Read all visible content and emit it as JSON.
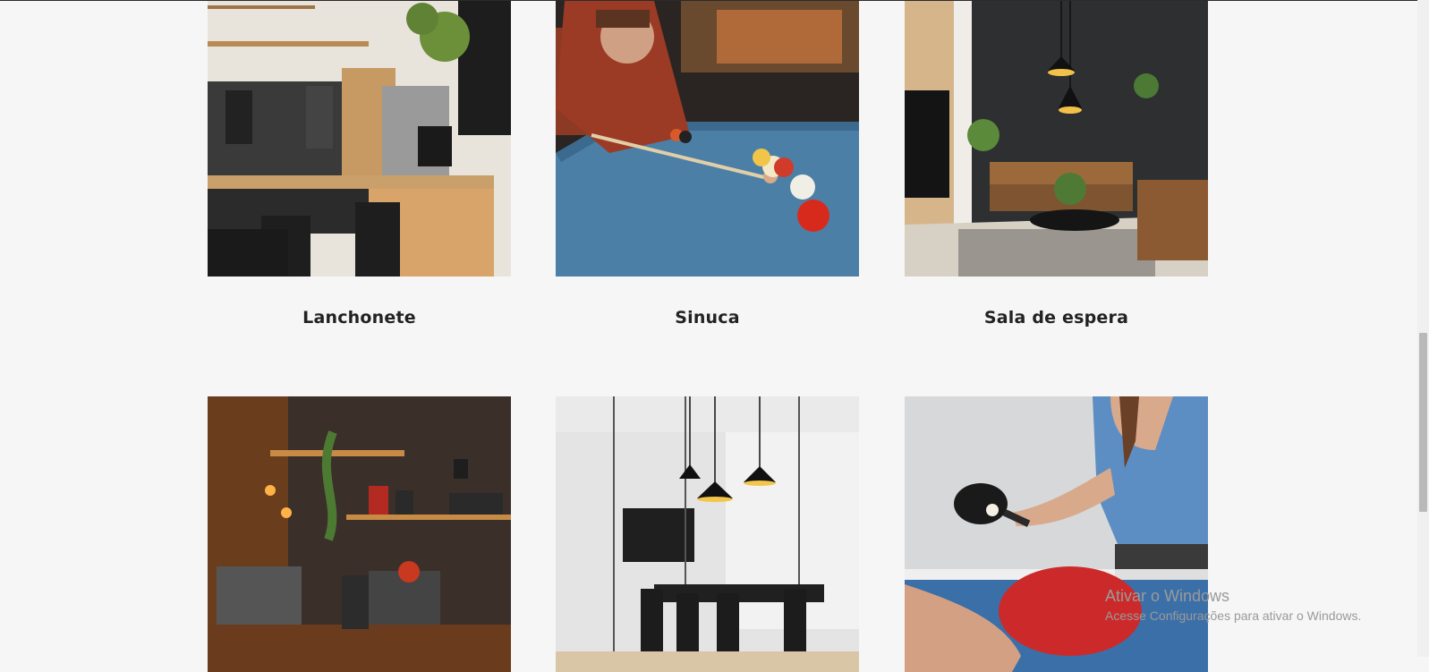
{
  "gallery": {
    "items": [
      {
        "label": "Lanchonete",
        "image": "coffee-bar-photo"
      },
      {
        "label": "Sinuca",
        "image": "pool-table-photo"
      },
      {
        "label": "Sala de espera",
        "image": "lounge-photo"
      },
      {
        "label": "",
        "image": "coffee-shelf-photo"
      },
      {
        "label": "",
        "image": "meeting-room-photo"
      },
      {
        "label": "",
        "image": "ping-pong-photo"
      }
    ]
  },
  "windows_activation": {
    "title": "Ativar o Windows",
    "subtitle": "Acesse Configurações para ativar o Windows."
  }
}
